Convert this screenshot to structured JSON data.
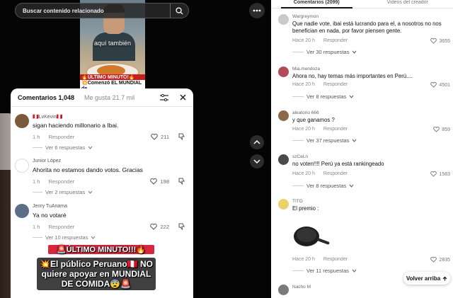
{
  "search": {
    "placeholder": "Buscar contenido relacionado"
  },
  "video": {
    "caption": "aquí también",
    "banner_top": "🔥ÚLTIMO MINUTO!🔥",
    "banner_bottom": "💥Comenzó EL MUNDIAL de"
  },
  "overlay": {
    "line1": "🚨ÚLTIMO MINUTO!!!🔥",
    "line2": "💥El público Peruano🇵🇪 NO quiere apoyar en MUNDIAL DE COMIDA😨🚨"
  },
  "comments_panel": {
    "tab_comments": "Comentarios 1,048",
    "tab_likes": "Me gusta 21.7 mil",
    "items": [
      {
        "user": "🇵🇪LvKevin🇵🇪",
        "text": "sigan haciendo millonario a Ibai.",
        "time": "1 h",
        "reply": "Responder",
        "likes": "211",
        "more": "Ver 6 respuestas",
        "avatar_color": "#7a5a3a"
      },
      {
        "user": "Junior López",
        "text": "Ahorita no estamos dando votos. Gracias",
        "time": "1 h",
        "reply": "Responder",
        "likes": "198",
        "more": "Ver 2 respuestas",
        "avatar_color": "#ffffff"
      },
      {
        "user": "Jenry TuAnama",
        "text": "Ya no votaré",
        "time": "1 h",
        "reply": "Responder",
        "likes": "222",
        "more": "Ver 10 respuestas",
        "avatar_color": "#5a6e88"
      }
    ]
  },
  "right_panel": {
    "tab_comments": "Comentarios (2099)",
    "tab_creator": "Videos del creador",
    "items": [
      {
        "user": "Wargreymon",
        "text": "Que nadie vote, ibai está lucrando para el, a nosotros no nos benefician en nada, por favor piensen gente.",
        "time": "Hace 20 h",
        "reply": "Responder",
        "likes": "3655",
        "more": "Ver 30 respuestas",
        "avatar_color": "#c9c9c9"
      },
      {
        "user": "Mia.mendoza",
        "text": "Ahora no, hay temas más importantes en Perú....",
        "time": "Hace 20 h",
        "reply": "Responder",
        "likes": "4501",
        "more": "Ver 8 respuestas",
        "avatar_color": "#b24a5a"
      },
      {
        "user": "aleatorio 666",
        "text": "y que ganamos ?",
        "time": "Hace 20 h",
        "reply": "Responder",
        "likes": "859",
        "more": "Ver 37 respuestas",
        "avatar_color": "#8a6a4a"
      },
      {
        "user": "szCeLn",
        "text": "no voten!!!! Perú ya está rankingeado",
        "time": "Hace 20 h",
        "reply": "Responder",
        "likes": "1583",
        "more": "Ver 8 respuestas",
        "avatar_color": "#4a4a4a"
      },
      {
        "user": "TITO",
        "text": "El premio :",
        "time": "Hace 20 h",
        "reply": "Responder",
        "likes": "2835",
        "more": "Ver 11 respuestas",
        "avatar_color": "#e8d36a"
      },
      {
        "user": "Nacho M",
        "text": "",
        "time": "",
        "reply": "",
        "likes": "",
        "more": "",
        "avatar_color": "#7a7a7a"
      }
    ],
    "back_to_top": "Volver arriba"
  }
}
